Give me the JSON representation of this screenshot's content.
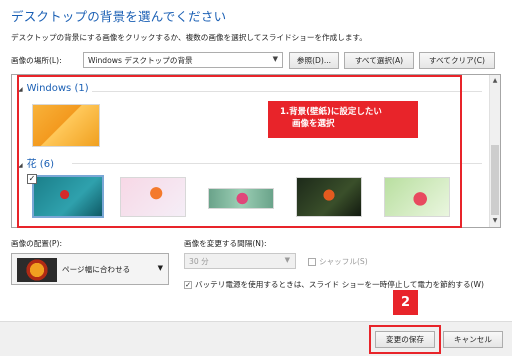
{
  "dialog": {
    "title": "デスクトップの背景を選んでください",
    "description": "デスクトップの背景にする画像をクリックするか、複数の画像を選択してスライドショーを作成します。"
  },
  "location": {
    "label": "画像の場所(L):",
    "value": "Windows デスクトップの背景",
    "browse": "参照(D)...",
    "select_all": "すべて選択(A)",
    "clear_all": "すべてクリア(C)"
  },
  "gallery": {
    "groups": [
      {
        "name": "Windows (1)"
      },
      {
        "name": "花 (6)"
      }
    ],
    "selected": "1"
  },
  "annotations": {
    "callout_line1": "1.背景(壁紙)に設定したい",
    "callout_line2": "画像を選択",
    "step2": "2"
  },
  "position": {
    "label": "画像の配置(P):",
    "value": "ページ幅に合わせる"
  },
  "interval": {
    "label": "画像を変更する間隔(N):",
    "value": "30 分",
    "shuffle": "シャッフル(S)",
    "battery": "バッテリ電源を使用するときは、スライド ショーを一時停止して電力を節約する(W)"
  },
  "footer": {
    "save": "変更の保存",
    "cancel": "キャンセル"
  },
  "colors": {
    "accent": "#1a5fb4",
    "annotation": "#e8242a"
  }
}
